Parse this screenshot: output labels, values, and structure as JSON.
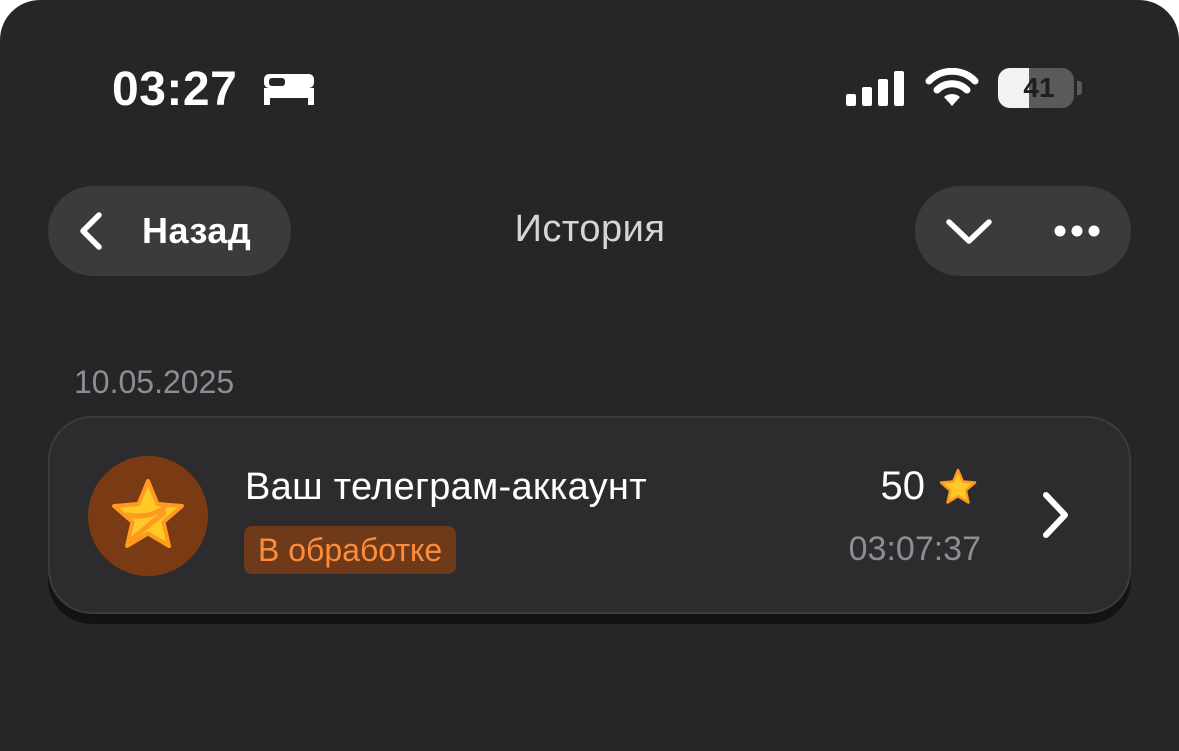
{
  "status_bar": {
    "time": "03:27",
    "focus_icon": "bed-icon",
    "signal_icon": "cellular-signal-icon",
    "wifi_icon": "wifi-icon",
    "battery_percent": 41,
    "battery_label": "41"
  },
  "nav": {
    "back_label": "Назад",
    "title": "История",
    "back_icon": "chevron-left-icon",
    "collapse_icon": "chevron-down-icon",
    "more_icon": "more-dots-icon"
  },
  "history": {
    "date": "10.05.2025",
    "items": [
      {
        "title": "Ваш телеграм-аккаунт",
        "status": "В обработке",
        "amount": "50",
        "time": "03:07:37",
        "icon": "star-icon",
        "amount_icon": "star-icon"
      }
    ]
  },
  "colors": {
    "background": "#262628",
    "card": "#2c2c2e",
    "status_text": "#ff8c3a",
    "status_bg": "#6e3a1a",
    "avatar_bg": "#7a3a14",
    "star": "#ffc928"
  }
}
